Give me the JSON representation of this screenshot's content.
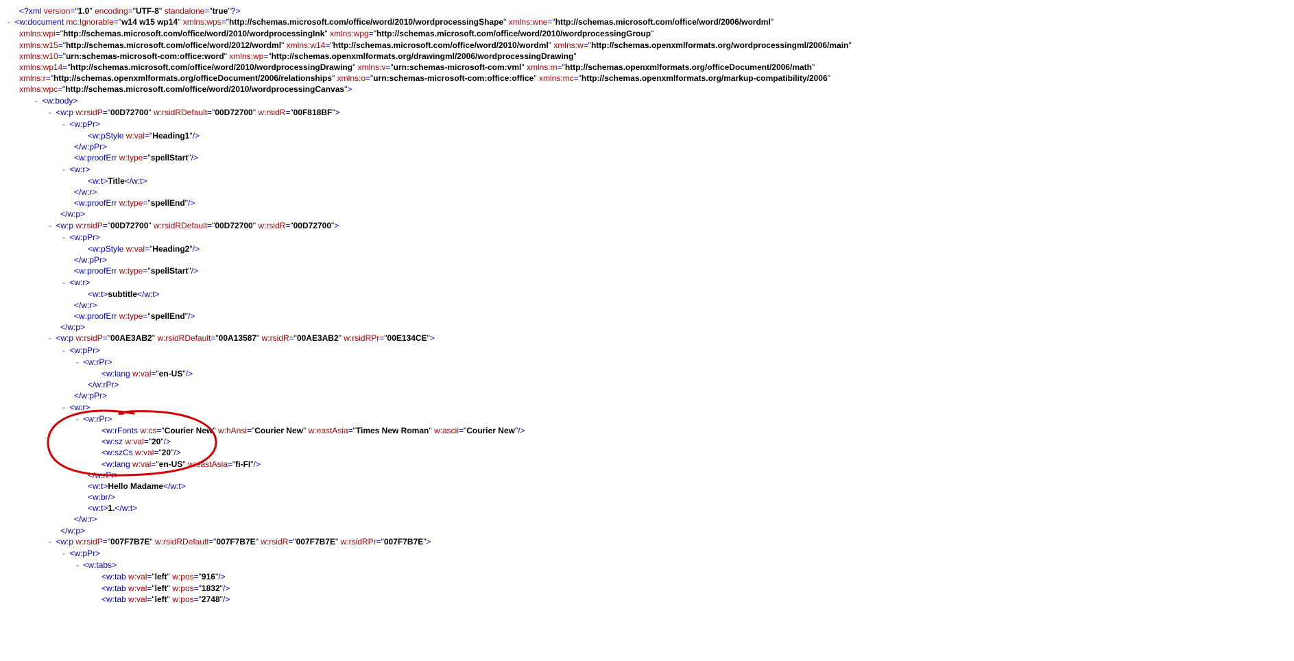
{
  "toggle": {
    "minus": "-"
  },
  "xml_decl": {
    "open": "<?",
    "name": "xml",
    "a1n": "version",
    "a1v": "1.0",
    "a2n": "encoding",
    "a2v": "UTF-8",
    "a3n": "standalone",
    "a3v": "true",
    "close": "?>"
  },
  "doc": {
    "open": "<",
    "name": "w:document",
    "ig_n": "mc:Ignorable",
    "ig_v": "w14 w15 wp14",
    "ns": [
      {
        "n": "xmlns:wps",
        "v": "http://schemas.microsoft.com/office/word/2010/wordprocessingShape"
      },
      {
        "n": "xmlns:wne",
        "v": "http://schemas.microsoft.com/office/word/2006/wordml"
      },
      {
        "n": "xmlns:wpi",
        "v": "http://schemas.microsoft.com/office/word/2010/wordprocessingInk"
      },
      {
        "n": "xmlns:wpg",
        "v": "http://schemas.microsoft.com/office/word/2010/wordprocessingGroup"
      },
      {
        "n": "xmlns:w15",
        "v": "http://schemas.microsoft.com/office/word/2012/wordml"
      },
      {
        "n": "xmlns:w14",
        "v": "http://schemas.microsoft.com/office/word/2010/wordml"
      },
      {
        "n": "xmlns:w",
        "v": "http://schemas.openxmlformats.org/wordprocessingml/2006/main"
      },
      {
        "n": "xmlns:w10",
        "v": "urn:schemas-microsoft-com:office:word"
      },
      {
        "n": "xmlns:wp",
        "v": "http://schemas.openxmlformats.org/drawingml/2006/wordprocessingDrawing"
      },
      {
        "n": "xmlns:wp14",
        "v": "http://schemas.microsoft.com/office/word/2010/wordprocessingDrawing"
      },
      {
        "n": "xmlns:v",
        "v": "urn:schemas-microsoft-com:vml"
      },
      {
        "n": "xmlns:m",
        "v": "http://schemas.openxmlformats.org/officeDocument/2006/math"
      },
      {
        "n": "xmlns:r",
        "v": "http://schemas.openxmlformats.org/officeDocument/2006/relationships"
      },
      {
        "n": "xmlns:o",
        "v": "urn:schemas-microsoft-com:office:office"
      },
      {
        "n": "xmlns:mc",
        "v": "http://schemas.openxmlformats.org/markup-compatibility/2006"
      },
      {
        "n": "xmlns:wpc",
        "v": "http://schemas.microsoft.com/office/word/2010/wordprocessingCanvas"
      }
    ],
    "close": ">"
  },
  "body": {
    "open": "<",
    "name": "w:body",
    "close": ">"
  },
  "p1": {
    "tag": "w:p",
    "rsidP_n": "w:rsidP",
    "rsidP_v": "00D72700",
    "rsidRD_n": "w:rsidRDefault",
    "rsidRD_v": "00D72700",
    "rsidR_n": "w:rsidR",
    "rsidR_v": "00F818BF",
    "ppr": "w:pPr",
    "ppr_close": "</w:pPr>",
    "pstyle": "w:pStyle",
    "val_n": "w:val",
    "val_v": "Heading1",
    "proofErr": "w:proofErr",
    "type_n": "w:type",
    "spellStart": "spellStart",
    "r": "w:r",
    "r_close": "</w:r>",
    "t_open": "<w:t>",
    "t_text": "Title",
    "t_close": "</w:t>",
    "spellEnd": "spellEnd",
    "p_close": "</w:p>"
  },
  "p2": {
    "tag": "w:p",
    "rsidP_n": "w:rsidP",
    "rsidP_v": "00D72700",
    "rsidRD_n": "w:rsidRDefault",
    "rsidRD_v": "00D72700",
    "rsidR_n": "w:rsidR",
    "rsidR_v": "00D72700",
    "ppr": "w:pPr",
    "ppr_close": "</w:pPr>",
    "pstyle": "w:pStyle",
    "val_n": "w:val",
    "val_v": "Heading2",
    "proofErr": "w:proofErr",
    "type_n": "w:type",
    "spellStart": "spellStart",
    "r": "w:r",
    "r_close": "</w:r>",
    "t_open": "<w:t>",
    "t_text": "subtitle",
    "t_close": "</w:t>",
    "spellEnd": "spellEnd",
    "p_close": "</w:p>"
  },
  "p3": {
    "tag": "w:p",
    "rsidP_n": "w:rsidP",
    "rsidP_v": "00AE3AB2",
    "rsidRD_n": "w:rsidRDefault",
    "rsidRD_v": "00A13587",
    "rsidR_n": "w:rsidR",
    "rsidR_v": "00AE3AB2",
    "rsidRPr_n": "w:rsidRPr",
    "rsidRPr_v": "00E134CE",
    "ppr": "w:pPr",
    "ppr_close": "</w:pPr>",
    "rpr": "w:rPr",
    "rpr_close": "</w:rPr>",
    "lang": "w:lang",
    "val_n": "w:val",
    "lang_v": "en-US",
    "r": "w:r",
    "r_close": "</w:r>",
    "rfonts": "w:rFonts",
    "cs_n": "w:cs",
    "cs_v": "Courier New",
    "hAnsi_n": "w:hAnsi",
    "hAnsi_v": "Courier New",
    "eastAsia_n": "w:eastAsia",
    "eastAsia_v": "Times New Roman",
    "ascii_n": "w:ascii",
    "ascii_v": "Courier New",
    "sz": "w:sz",
    "sz_v": "20",
    "szCs": "w:szCs",
    "szCs_v": "20",
    "lang2": "w:lang",
    "lang2_val": "en-US",
    "lang2_ea_n": "w:eastAsia",
    "lang2_ea_v": "fi-FI",
    "t_open": "<w:t>",
    "t_text": "Hello Madame",
    "t_close": "</w:t>",
    "br": "<w:br/>",
    "t2_open": "<w:t>",
    "t2_text": "1.",
    "t2_close": "</w:t>",
    "p_close": "</w:p>"
  },
  "p4": {
    "tag": "w:p",
    "rsidP_n": "w:rsidP",
    "rsidP_v": "007F7B7E",
    "rsidRD_n": "w:rsidRDefault",
    "rsidRD_v": "007F7B7E",
    "rsidR_n": "w:rsidR",
    "rsidR_v": "007F7B7E",
    "rsidRPr_n": "w:rsidRPr",
    "rsidRPr_v": "007F7B7E",
    "ppr": "w:pPr",
    "tabs": "w:tabs",
    "tab": "w:tab",
    "tval_n": "w:val",
    "tval": "left",
    "pos_n": "w:pos",
    "pos1": "916",
    "pos2": "1832",
    "pos3": "2748"
  }
}
